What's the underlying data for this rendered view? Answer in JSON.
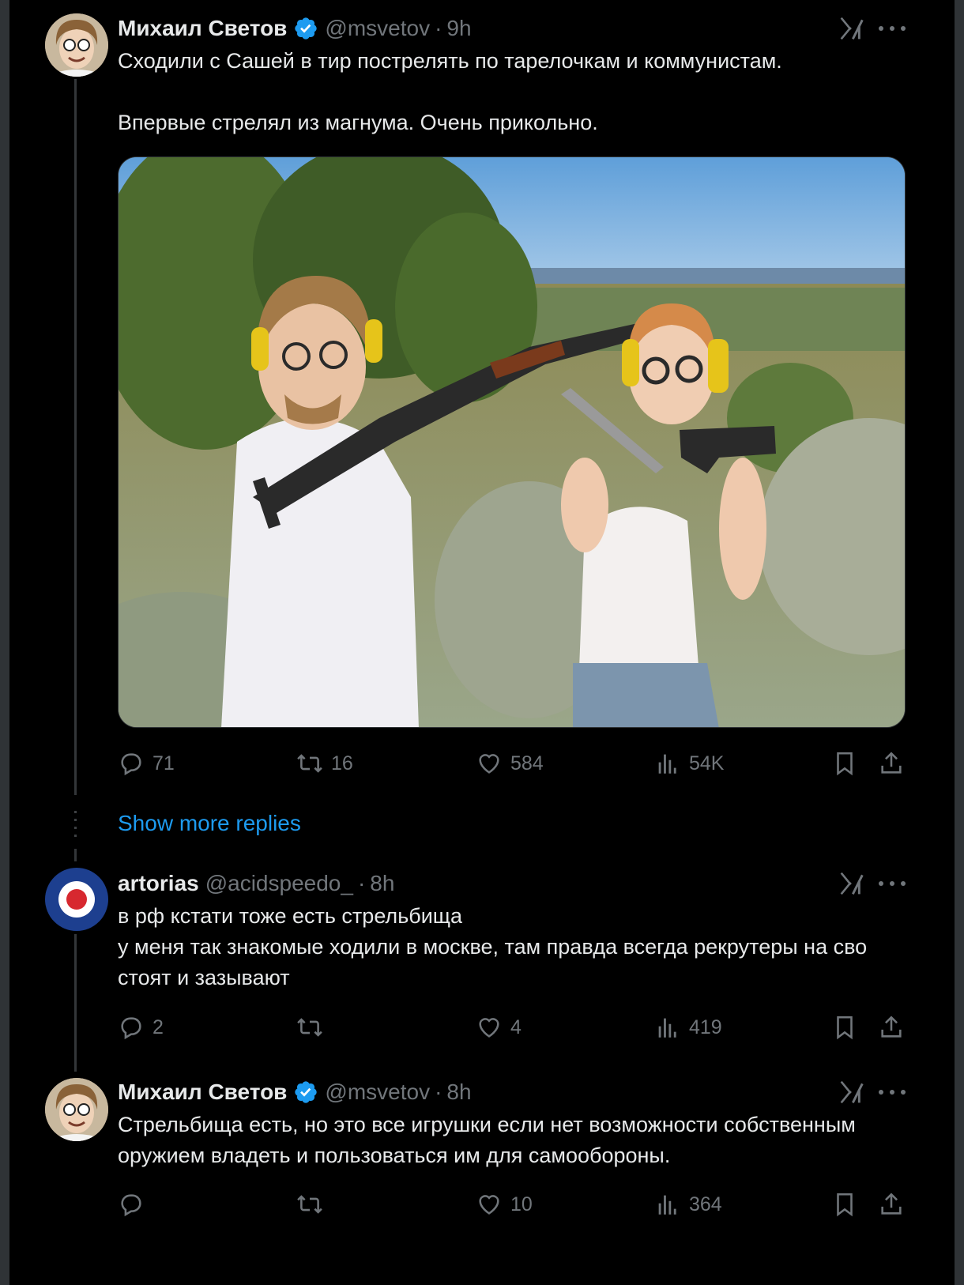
{
  "tweets": [
    {
      "name": "Михаил Светов",
      "handle": "@msvetov",
      "separator": "·",
      "time": "9h",
      "text": "Сходили с Сашей в тир пострелять по тарелочкам и коммунистам.\n\nВпервые стрелял из магнума. Очень прикольно.",
      "replies": "71",
      "reposts": "16",
      "likes": "584",
      "views": "54K"
    },
    {
      "name": "artorias",
      "handle": "@acidspeedo_",
      "separator": "·",
      "time": "8h",
      "text": "в рф кстати тоже есть стрельбища\nу меня так знакомые ходили в москве, там правда всегда рекрутеры на сво стоят и зазывают",
      "replies": "2",
      "reposts": "",
      "likes": "4",
      "views": "419"
    },
    {
      "name": "Михаил Светов",
      "handle": "@msvetov",
      "separator": "·",
      "time": "8h",
      "text": "Стрельбища есть, но это все игрушки если нет возможности собственным оружием владеть и пользоваться им для самообороны.",
      "replies": "",
      "reposts": "",
      "likes": "10",
      "views": "364"
    }
  ],
  "show_more_replies": "Show more replies",
  "icons": {
    "verified": "verified-badge-icon",
    "grok": "grok-icon",
    "more": "more-icon",
    "reply": "reply-icon",
    "repost": "repost-icon",
    "like": "like-icon",
    "views": "views-icon",
    "bookmark": "bookmark-icon",
    "share": "share-icon"
  },
  "colors": {
    "background": "#000000",
    "text": "#e7e9ea",
    "secondary": "#71767b",
    "link": "#1d9bf0",
    "verified": "#1d9bf0"
  }
}
